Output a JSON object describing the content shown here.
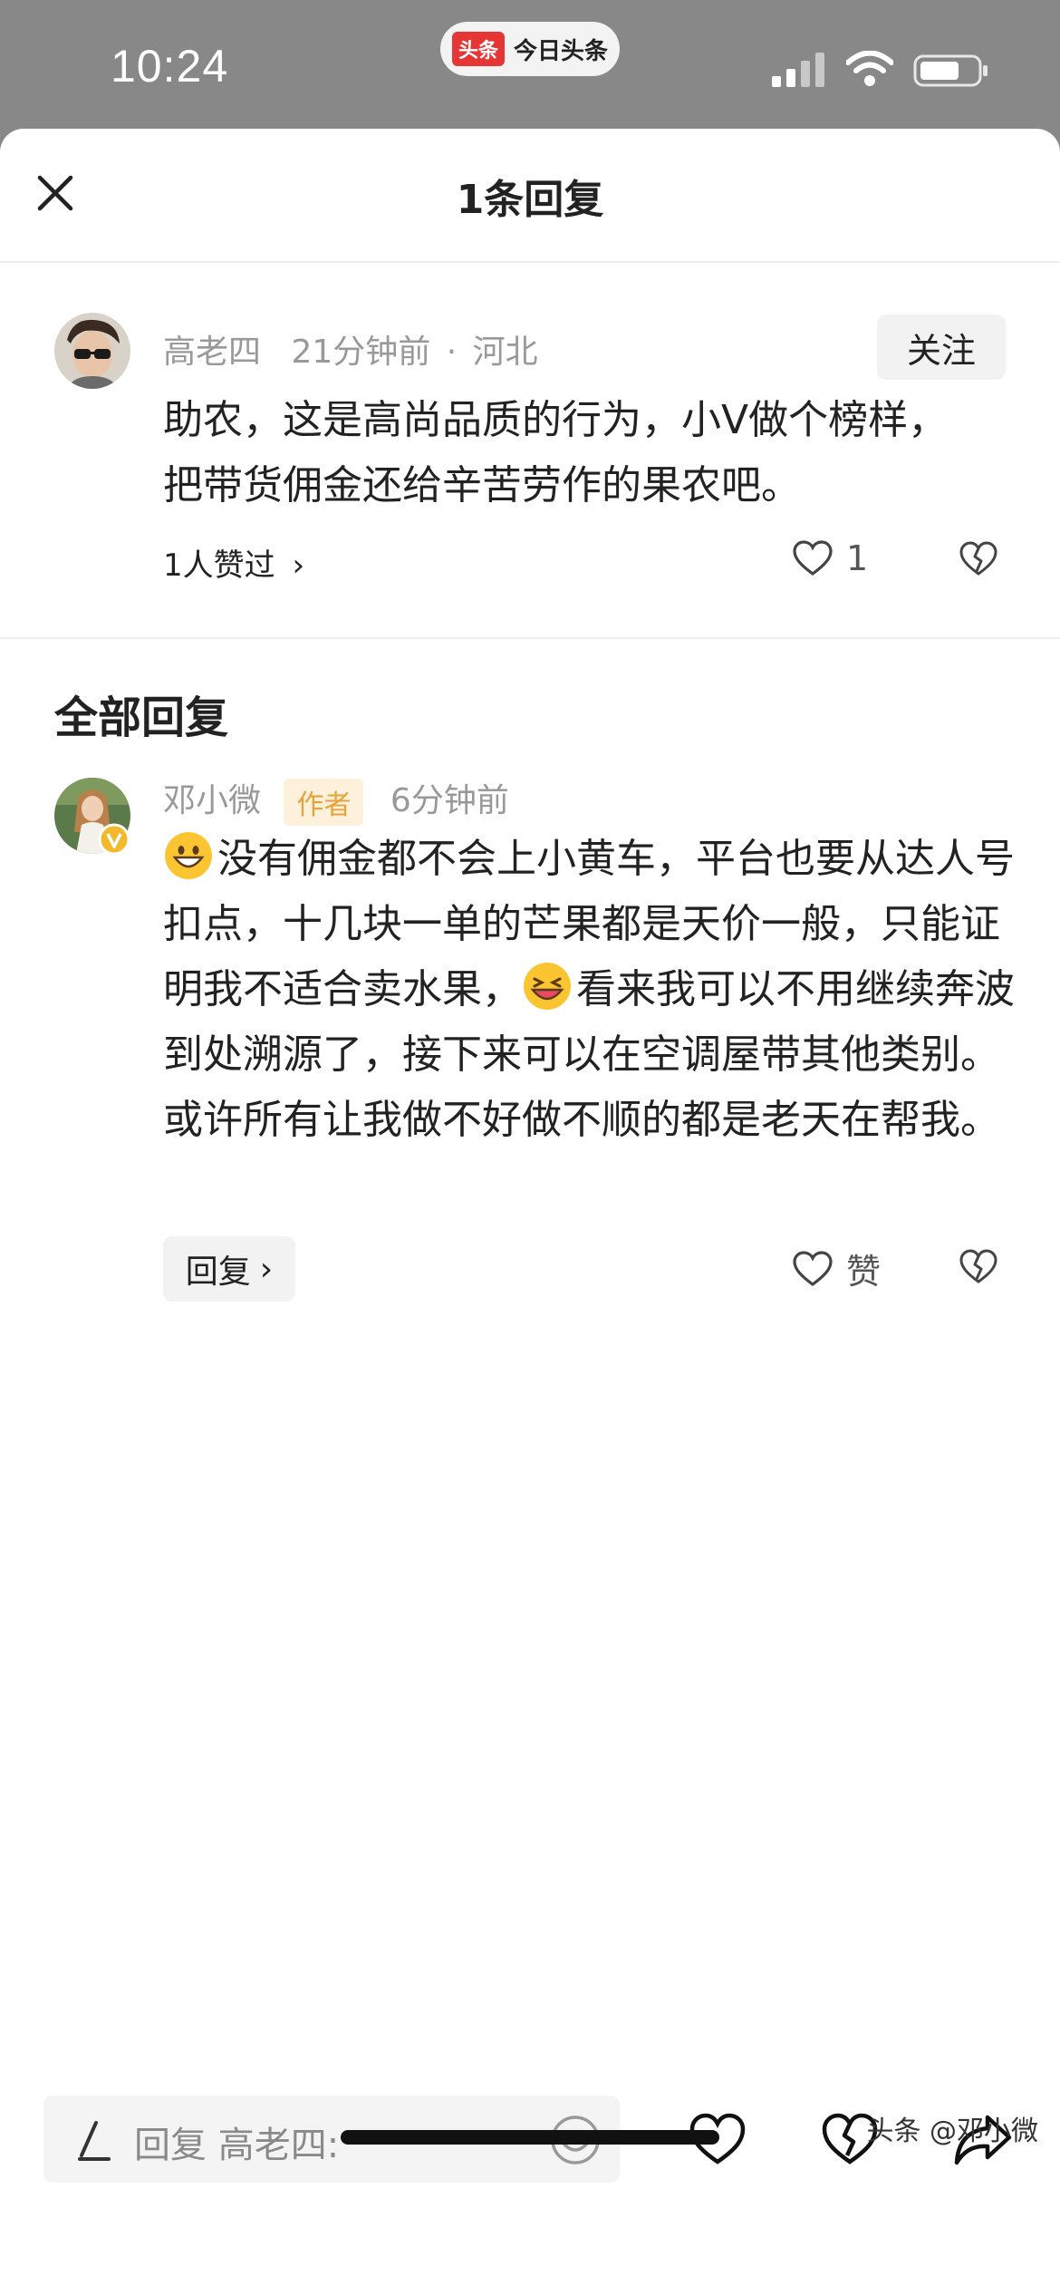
{
  "status_bar": {
    "time": "10:24",
    "app_logo": "头条",
    "app_name": "今日头条"
  },
  "header": {
    "title": "1条回复",
    "close_icon": "close-icon"
  },
  "original_comment": {
    "author": "高老四",
    "time": "21分钟前",
    "separator": "·",
    "location": "河北",
    "follow_label": "关注",
    "text": "助农，这是高尚品质的行为，小V做个榜样，把带货佣金还给辛苦劳作的果农吧。",
    "likers_label": "1人赞过",
    "like_count": "1"
  },
  "section": {
    "title": "全部回复"
  },
  "reply": {
    "author": "邓小微",
    "badge": "作者",
    "time": "6分钟前",
    "text_part1": "没有佣金都不会上小黄车，平台也要从达人号扣点，十几块一单的芒果都是天价一般，只能证明我不适合卖水果，",
    "text_part2": "看来我可以不用继续奔波到处溯源了，接下来可以在空调屋带其他类别。或许所有让我做不好做不顺的都是老天在帮我。",
    "reply_label": "回复",
    "like_label": "赞"
  },
  "bottom_bar": {
    "placeholder": "回复 高老四:"
  },
  "watermark": "头条 @邓小微",
  "colors": {
    "author_badge_bg": "#fdf1dc",
    "author_badge_text": "#e8a23a",
    "verified": "#f2b92c"
  }
}
